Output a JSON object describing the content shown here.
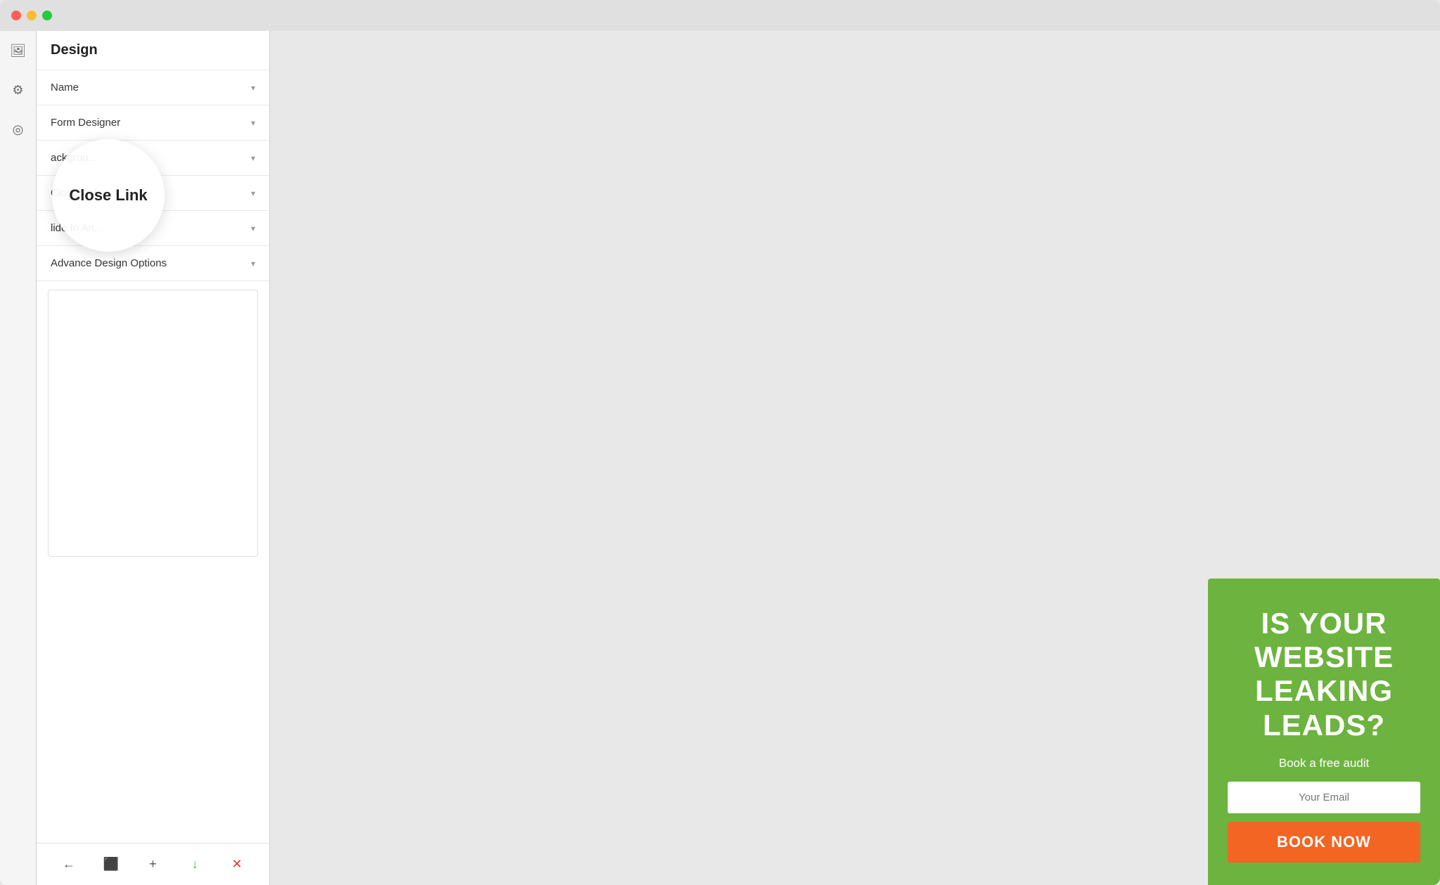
{
  "titlebar": {
    "traffic_lights": [
      "close",
      "minimize",
      "maximize"
    ]
  },
  "panel": {
    "title": "Design",
    "accordion_items": [
      {
        "id": "name",
        "label": "Name"
      },
      {
        "id": "form-designer",
        "label": "Form Designer"
      },
      {
        "id": "background",
        "label": "Background"
      },
      {
        "id": "close-link",
        "label": "Close Link"
      },
      {
        "id": "slide-in-animation",
        "label": "Slide In An..."
      },
      {
        "id": "advance-design-options",
        "label": "Advance Design Options"
      }
    ]
  },
  "close_link_tooltip": {
    "label": "Close Link"
  },
  "toolbar": {
    "back_label": "←",
    "preview_label": "⬜",
    "add_label": "+",
    "save_label": "↓",
    "close_label": "✕"
  },
  "popup": {
    "headline": "IS YOUR WEBSITE LEAKING LEADS?",
    "subtext": "Book a free audit",
    "email_placeholder": "Your Email",
    "cta_label": "BOOK NOW",
    "bg_color": "#6db33f",
    "cta_color": "#f26522"
  },
  "icons": {
    "image": "🖼",
    "settings": "⚙",
    "target": "◎"
  }
}
